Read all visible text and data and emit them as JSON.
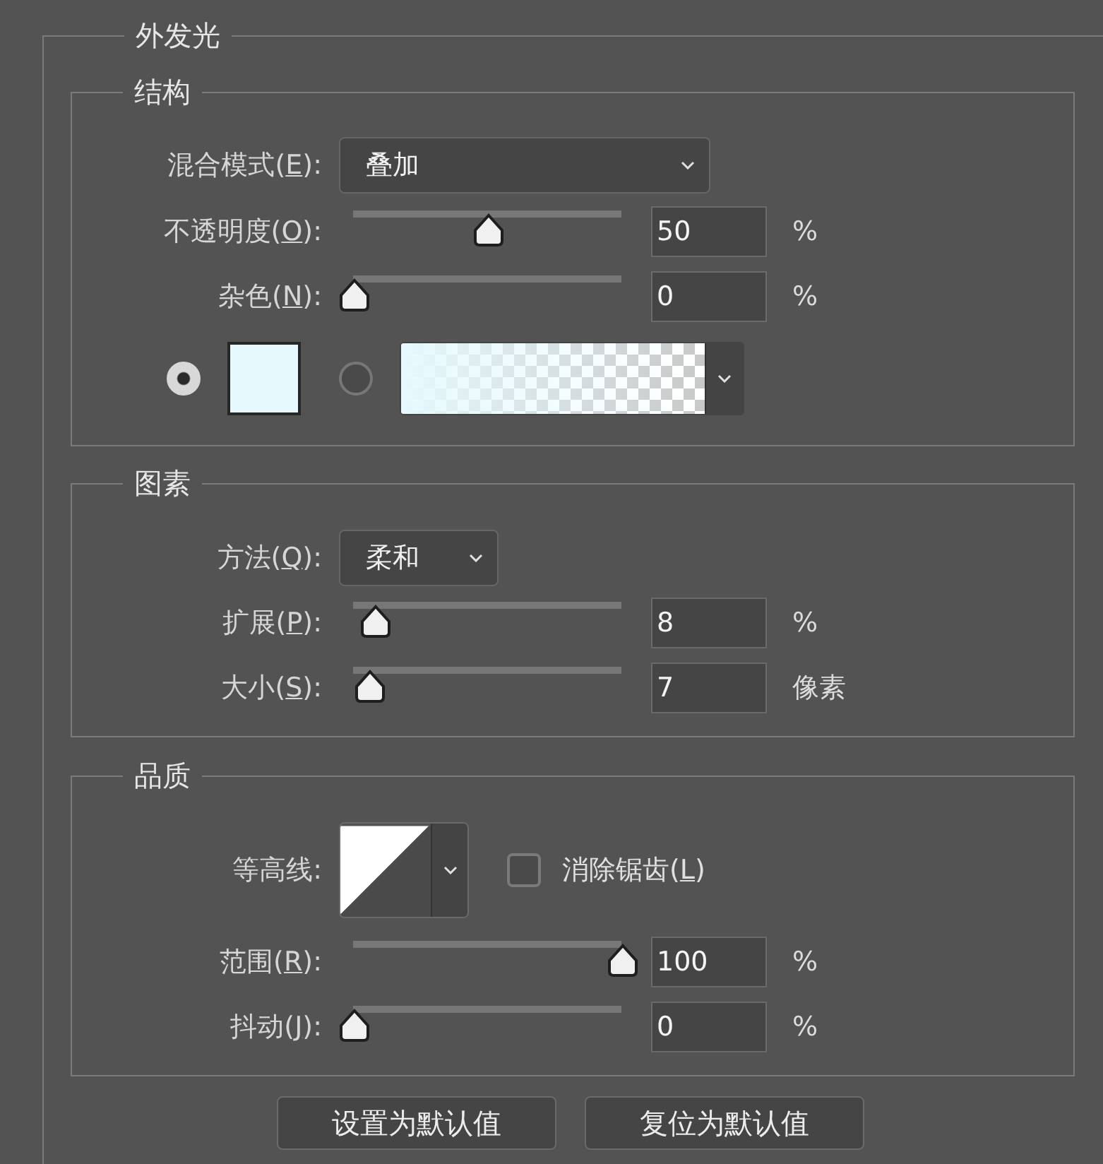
{
  "title": "外发光",
  "sections": [
    {
      "title": "结构",
      "rows": [
        {
          "kind": "dropdown",
          "label": [
            "混合模式(",
            "E",
            "):"
          ],
          "value": "叠加"
        },
        {
          "kind": "slider",
          "label": [
            "不透明度(",
            "O",
            "):"
          ],
          "level": 0.5,
          "value": "50",
          "unit": "%"
        },
        {
          "kind": "slider",
          "label": [
            "杂色(",
            "N",
            "):"
          ],
          "level": 0,
          "value": "0",
          "unit": "%"
        },
        {
          "kind": "fill",
          "radios": [
            {
              "selected": true
            },
            {
              "selected": false
            }
          ],
          "color": "#e6f9fd"
        }
      ]
    },
    {
      "title": "图素",
      "rows": [
        {
          "kind": "short-dropdown",
          "label": [
            "方法(",
            "Q",
            "):"
          ],
          "value": "柔和"
        },
        {
          "kind": "slider",
          "label": [
            "扩展(",
            "P",
            "):"
          ],
          "level": 0.08,
          "value": "8",
          "unit": "%"
        },
        {
          "kind": "slider",
          "label": [
            "大小(",
            "S",
            "):"
          ],
          "level": 0.06,
          "value": "7",
          "unit": "像素"
        }
      ]
    },
    {
      "title": "品质",
      "rows": [
        {
          "kind": "contour",
          "label": [
            "等高线:"
          ],
          "checkbox": {
            "label": [
              "消除锯齿(",
              "L",
              ")"
            ],
            "checked": false
          }
        },
        {
          "kind": "slider",
          "label": [
            "范围(",
            "R",
            "):"
          ],
          "level": 1,
          "value": "100",
          "unit": "%"
        },
        {
          "kind": "slider",
          "label": [
            "抖动(",
            "J",
            "):"
          ],
          "level": 0,
          "value": "0",
          "unit": "%"
        }
      ]
    }
  ],
  "buttons": [
    "设置为默认值",
    "复位为默认值"
  ]
}
